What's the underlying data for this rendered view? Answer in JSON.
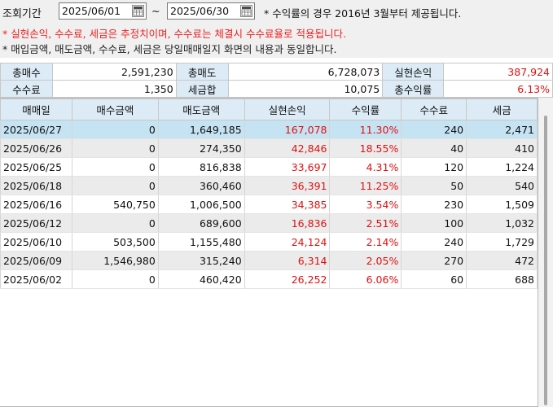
{
  "header": {
    "period_label": "조회기간",
    "start_date": "2025/06/01",
    "tilde": "~",
    "end_date": "2025/06/30",
    "note": "* 수익률의 경우 2016년 3월부터 제공됩니다.",
    "notice_red": "* 실현손익, 수수료, 세금은 추정치이며, 수수료는 체결시 수수료율로 적용됩니다.",
    "notice_gray": "* 매입금액, 매도금액, 수수료, 세금은 당일매매일지 화면의 내용과 동일합니다."
  },
  "summary": {
    "total_buy_label": "총매수",
    "total_buy": "2,591,230",
    "total_sell_label": "총매도",
    "total_sell": "6,728,073",
    "realized_label": "실현손익",
    "realized": "387,924",
    "fee_label": "수수료",
    "fee": "1,350",
    "tax_label": "세금합",
    "tax": "10,075",
    "return_label": "총수익률",
    "return": "6.13%"
  },
  "table": {
    "columns": [
      "매매일",
      "매수금액",
      "매도금액",
      "실현손익",
      "수익률",
      "수수료",
      "세금"
    ],
    "rows": [
      [
        "2025/06/27",
        "0",
        "1,649,185",
        "167,078",
        "11.30%",
        "240",
        "2,471"
      ],
      [
        "2025/06/26",
        "0",
        "274,350",
        "42,846",
        "18.55%",
        "40",
        "410"
      ],
      [
        "2025/06/25",
        "0",
        "816,838",
        "33,697",
        "4.31%",
        "120",
        "1,224"
      ],
      [
        "2025/06/18",
        "0",
        "360,460",
        "36,391",
        "11.25%",
        "50",
        "540"
      ],
      [
        "2025/06/16",
        "540,750",
        "1,006,500",
        "34,385",
        "3.54%",
        "230",
        "1,509"
      ],
      [
        "2025/06/12",
        "0",
        "689,600",
        "16,836",
        "2.51%",
        "100",
        "1,032"
      ],
      [
        "2025/06/10",
        "503,500",
        "1,155,480",
        "24,124",
        "2.14%",
        "240",
        "1,729"
      ],
      [
        "2025/06/09",
        "1,546,980",
        "315,240",
        "6,314",
        "2.05%",
        "270",
        "472"
      ],
      [
        "2025/06/02",
        "0",
        "460,420",
        "26,252",
        "6.06%",
        "60",
        "688"
      ]
    ]
  },
  "colors": {
    "positive": "#e01010",
    "header_bg": "#dcebf6",
    "selected_row": "#c5e3f3"
  },
  "icons": {
    "calendar": "calendar-icon"
  }
}
